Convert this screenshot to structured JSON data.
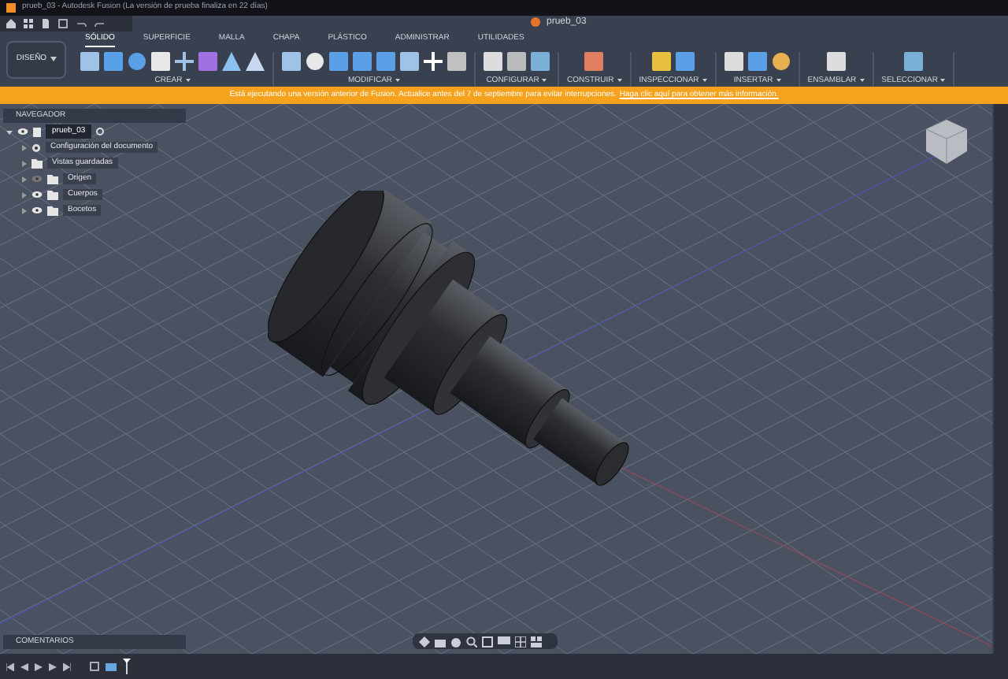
{
  "title_bar": {
    "title": "prueb_03 - Autodesk Fusion (La versión de prueba finaliza en 22 días)"
  },
  "document_tab": {
    "title": "prueb_03"
  },
  "workspace_button": {
    "label": "DISEÑO"
  },
  "toolbar_tabs": [
    {
      "label": "SÓLIDO",
      "selected": true
    },
    {
      "label": "SUPERFICIE",
      "selected": false
    },
    {
      "label": "MALLA",
      "selected": false
    },
    {
      "label": "CHAPA",
      "selected": false
    },
    {
      "label": "PLÁSTICO",
      "selected": false
    },
    {
      "label": "ADMINISTRAR",
      "selected": false
    },
    {
      "label": "UTILIDADES",
      "selected": false
    }
  ],
  "tool_groups": [
    {
      "label": "CREAR"
    },
    {
      "label": "MODIFICAR"
    },
    {
      "label": "CONFIGURAR"
    },
    {
      "label": "CONSTRUIR"
    },
    {
      "label": "INSPECCIONAR"
    },
    {
      "label": "INSERTAR"
    },
    {
      "label": "ENSAMBLAR"
    },
    {
      "label": "SELECCIONAR"
    }
  ],
  "banner": {
    "message": "Está ejecutando una versión anterior de Fusion. Actualice antes del 7 de septiembre para evitar interrupciones.",
    "link": "Haga clic aquí para obtener más información."
  },
  "navigator": {
    "title": "NAVEGADOR",
    "root": {
      "label": "prueb_03",
      "selected": true,
      "expanded": true,
      "children": [
        {
          "label": "Configuración del documento",
          "kind": "settings",
          "selected": false
        },
        {
          "label": "Vistas guardadas",
          "kind": "folder",
          "selected": false
        },
        {
          "label": "Origen",
          "kind": "layer",
          "visible": false,
          "selected": false
        },
        {
          "label": "Cuerpos",
          "kind": "layer",
          "visible": true,
          "selected": false
        },
        {
          "label": "Bocetos",
          "kind": "layer",
          "visible": true,
          "selected": false
        }
      ]
    }
  },
  "comments_panel": {
    "title": "COMENTARIOS"
  }
}
